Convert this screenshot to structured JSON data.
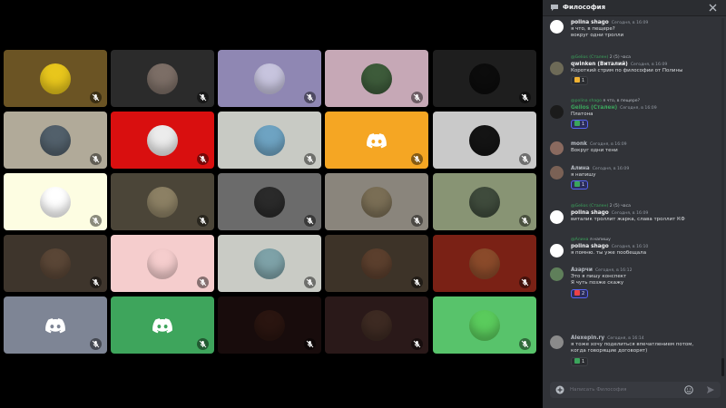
{
  "chat": {
    "title": "Философия",
    "composer_placeholder": "Написать Философия",
    "messages": [
      {
        "name": "polina shago",
        "name_color": "#f2f3f5",
        "time": "Сегодня, в 16:09",
        "lines": [
          "я что, в пещере?",
          "вокруг одни тролли"
        ]
      },
      {
        "reply": {
          "name": "@Gelios (Стален)",
          "text": "2 (5) часа"
        },
        "name": "qwinken (Виталий)",
        "name_color": "#f2f3f5",
        "time": "Сегодня, в 16:09",
        "lines": [
          "Короткий стрим по философии от Полины"
        ],
        "reaction": "1"
      },
      {
        "reply": {
          "name": "@polina shago",
          "text": "я что, в пещере?"
        },
        "name": "Gelios (Стален)",
        "name_color": "#3ba55c",
        "time": "Сегодня, в 16:09",
        "lines": [
          "Платона"
        ],
        "reaction": "1"
      },
      {
        "name": "monk",
        "name_color": "#b5bac1",
        "time": "Сегодня, в 16:09",
        "lines": [
          "Вокруг одни тени"
        ]
      },
      {
        "name": "Алина",
        "name_color": "#b5bac1",
        "time": "Сегодня, в 16:09",
        "lines": [
          "я напишу"
        ],
        "reaction": "1"
      },
      {
        "reply": {
          "name": "@Gelios (Стален)",
          "text": "2 (5) часа"
        },
        "name": "polina shago",
        "name_color": "#f2f3f5",
        "time": "Сегодня, в 16:09",
        "lines": [
          "виталик троллит жарка, слава троллит КФ"
        ]
      },
      {
        "reply": {
          "name": "@Алина",
          "text": "я напишу"
        },
        "name": "polina shago",
        "name_color": "#f2f3f5",
        "time": "Сегодня, в 16:10",
        "lines": [
          "я помню. ты уже пообещала"
        ]
      },
      {
        "name": "Азарчи",
        "name_color": "#b5bac1",
        "time": "Сегодня, в 16:12",
        "lines": [
          "Это я пишу конспект",
          "Я чуть позже скажу"
        ],
        "reaction": "2"
      },
      {
        "name": "Alexepin.rу",
        "name_color": "#b5bac1",
        "time": "Сегодня, в 16:14",
        "lines": [
          "я тоже хочу поделиться впечатлением потом,",
          "когда говорящие договорят)"
        ],
        "reaction": "1"
      }
    ]
  },
  "grid": {
    "tiles": [
      {
        "bg": "#6b5424",
        "avatar": "#e8c61c"
      },
      {
        "bg": "#2b2b2b",
        "avatar": "#7c6e66"
      },
      {
        "bg": "#8f87b3",
        "avatar": "#c7c4de"
      },
      {
        "bg": "#c6a8b6",
        "avatar": "#3d5b3a"
      },
      {
        "bg": "#1e1e1e",
        "avatar": "#0c0c0c"
      },
      {
        "bg": "#b1aa99",
        "avatar": "#52606b"
      },
      {
        "bg": "#d90f0f",
        "avatar": "#ececec"
      },
      {
        "bg": "#c8cac4",
        "avatar": "#6ea3c2"
      },
      {
        "bg": "#f5a623",
        "avatar": "#f5a623"
      },
      {
        "bg": "#c9c9c9",
        "avatar": "#141414"
      },
      {
        "bg": "#fdfde2",
        "avatar": "#ffffff"
      },
      {
        "bg": "#4b4538",
        "avatar": "#8c8064"
      },
      {
        "bg": "#6b6b6b",
        "avatar": "#2a2a2a"
      },
      {
        "bg": "#8a857c",
        "avatar": "#7a6e55"
      },
      {
        "bg": "#889474",
        "avatar": "#3f4b3c"
      },
      {
        "bg": "#3e352c",
        "avatar": "#5a4636"
      },
      {
        "bg": "#f5cdcd",
        "avatar": "#f5cdcd"
      },
      {
        "bg": "#c9cbc5",
        "avatar": "#7ea2a8"
      },
      {
        "bg": "#3d3328",
        "avatar": "#5b3f2d"
      },
      {
        "bg": "#7a2115",
        "avatar": "#8a4a2a"
      },
      {
        "bg": "#7e8595",
        "avatar": "#7e8595"
      },
      {
        "bg": "#3ea55c",
        "avatar": "#3ea55c"
      },
      {
        "bg": "#180c0c",
        "avatar": "#2a1510"
      },
      {
        "bg": "#2a1919",
        "avatar": "#3d2a22"
      },
      {
        "bg": "#58c36b",
        "avatar": "#5acb5c"
      }
    ]
  },
  "colors": {
    "chat_bg": "#313338",
    "reply_name": "#3ba55c",
    "reaction_blurple": "#5865f2",
    "discord_logo": "#ffffff"
  }
}
